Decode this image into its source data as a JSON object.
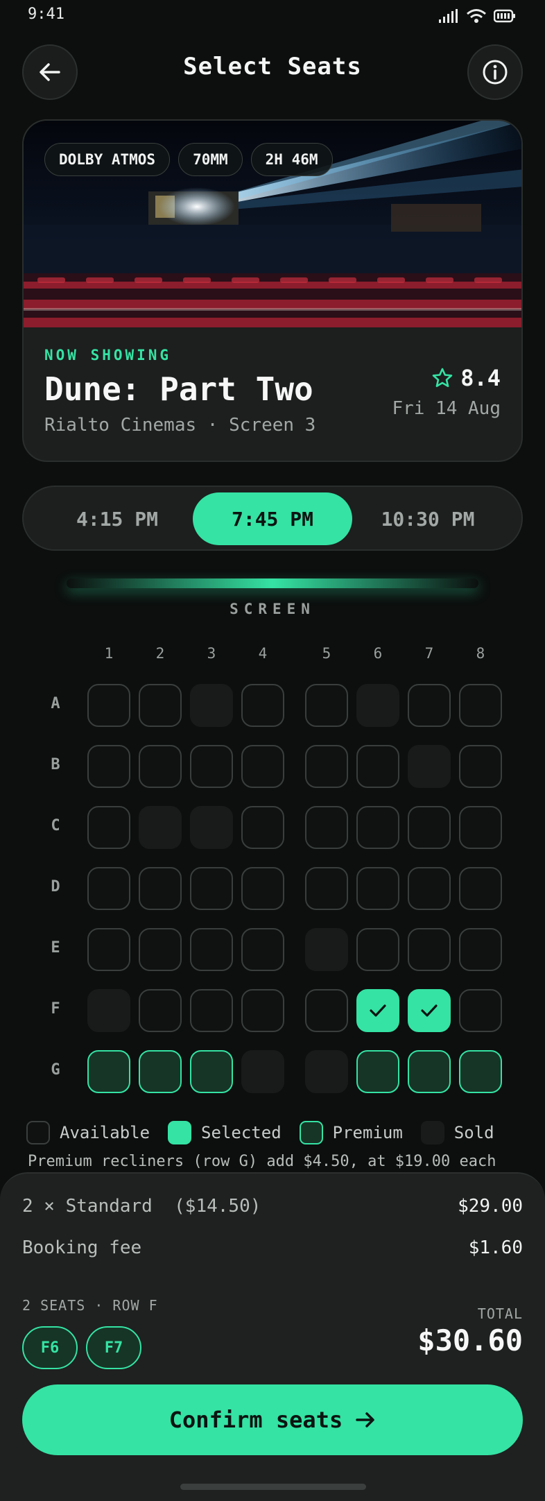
{
  "status_bar": {
    "time": "9:41"
  },
  "header": {
    "title": "Select Seats"
  },
  "movie": {
    "tags": [
      "DOLBY ATMOS",
      "70MM",
      "2H 46M"
    ],
    "badge": "NOW SHOWING",
    "title": "Dune: Part Two",
    "venue": "Rialto Cinemas · Screen 3",
    "rating": "8.4",
    "date": "Fri 14 Aug"
  },
  "showtimes": {
    "times": [
      "4:15 PM",
      "7:45 PM",
      "10:30 PM"
    ],
    "selected": "7:45 PM"
  },
  "screen_label": "SCREEN",
  "seat_map": {
    "columns": [
      "1",
      "2",
      "3",
      "4",
      "5",
      "6",
      "7",
      "8"
    ],
    "rows": [
      {
        "label": "A",
        "seats": [
          "available",
          "available",
          "sold",
          "available",
          "available",
          "sold",
          "available",
          "available"
        ]
      },
      {
        "label": "B",
        "seats": [
          "available",
          "available",
          "available",
          "available",
          "available",
          "available",
          "sold",
          "available"
        ]
      },
      {
        "label": "C",
        "seats": [
          "available",
          "sold",
          "sold",
          "available",
          "available",
          "available",
          "available",
          "available"
        ]
      },
      {
        "label": "D",
        "seats": [
          "available",
          "available",
          "available",
          "available",
          "available",
          "available",
          "available",
          "available"
        ]
      },
      {
        "label": "E",
        "seats": [
          "available",
          "available",
          "available",
          "available",
          "sold",
          "available",
          "available",
          "available"
        ]
      },
      {
        "label": "F",
        "seats": [
          "sold",
          "available",
          "available",
          "available",
          "available",
          "selected",
          "selected",
          "available"
        ]
      },
      {
        "label": "G",
        "seats": [
          "premium",
          "premium",
          "premium",
          "sold",
          "sold",
          "premium",
          "premium",
          "premium"
        ]
      }
    ]
  },
  "legend": {
    "available": "Available",
    "selected": "Selected",
    "premium": "Premium",
    "sold": "Sold"
  },
  "premium_note": "Premium recliners (row G) add $4.50, at $19.00 each",
  "summary": {
    "standard_label": "2 × Standard  ($14.50)",
    "standard_value": "$29.00",
    "fee_label": "Booking fee",
    "fee_value": "$1.60",
    "seats_caption": "2 SEATS · ROW F",
    "seats": [
      "F6",
      "F7"
    ],
    "total_label": "TOTAL",
    "total_value": "$30.60"
  },
  "cta": {
    "label": "Confirm seats"
  },
  "colors": {
    "accent": "#35e3a4",
    "background": "#0c0f0e",
    "card": "#1c1f1e"
  }
}
